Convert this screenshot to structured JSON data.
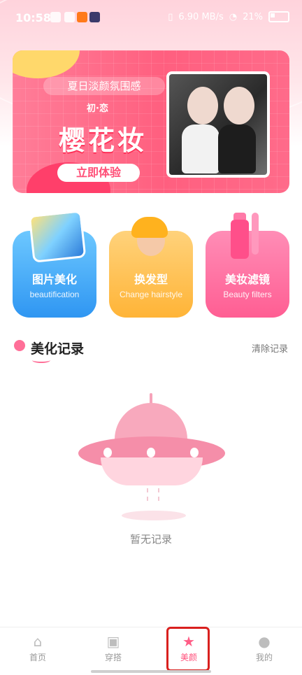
{
  "status_bar": {
    "time": "10:58",
    "network": "6.90 MB/s",
    "battery": "21%"
  },
  "banner": {
    "subtitle": "夏日淡颜氛围感",
    "brand": "初·恋",
    "title": "樱花妆",
    "cta": "立即体验"
  },
  "features": [
    {
      "title": "图片美化",
      "subtitle": "beautification"
    },
    {
      "title": "换发型",
      "subtitle": "Change hairstyle"
    },
    {
      "title": "美妆滤镜",
      "subtitle": "Beauty filters"
    }
  ],
  "history": {
    "title": "美化记录",
    "clear": "清除记录",
    "empty_text": "暂无记录"
  },
  "nav": {
    "items": [
      {
        "label": "首页",
        "icon": "home-icon"
      },
      {
        "label": "穿搭",
        "icon": "shirt-icon"
      },
      {
        "label": "美颜",
        "icon": "star-wand-icon"
      },
      {
        "label": "我的",
        "icon": "user-icon"
      }
    ],
    "active": "美颜",
    "colors": {
      "active": "#ff4f7a",
      "inactive": "#999999"
    }
  }
}
